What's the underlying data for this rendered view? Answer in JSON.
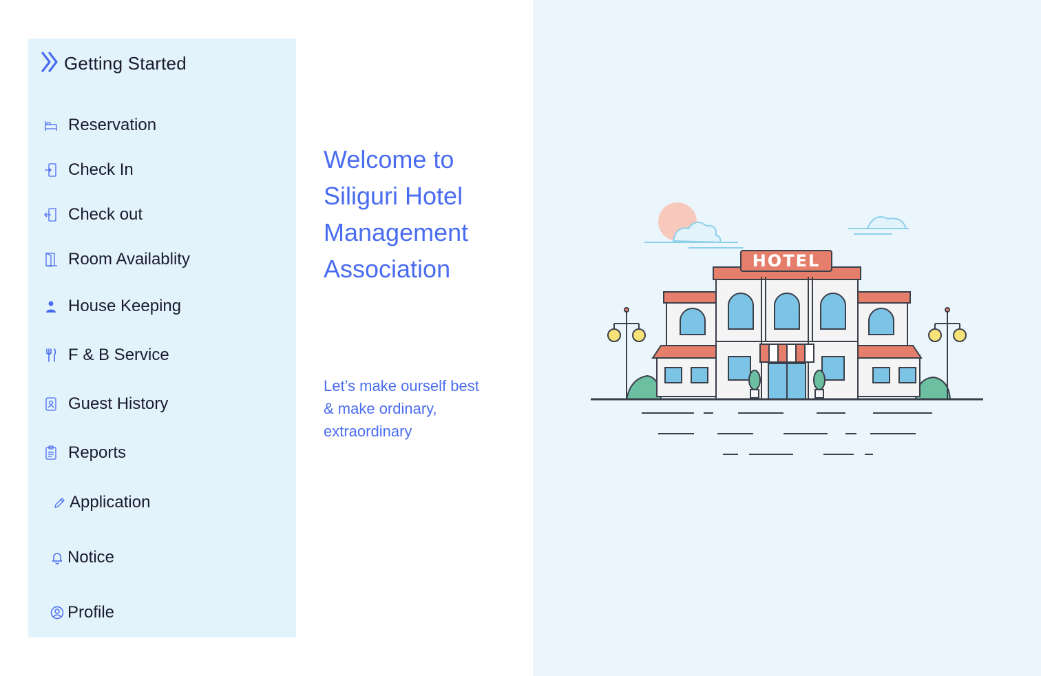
{
  "sidebar": {
    "header": {
      "label": "Getting Started",
      "icon": "double-chevron-right-icon"
    },
    "items": [
      {
        "label": "Reservation",
        "icon": "bed-icon"
      },
      {
        "label": "Check In",
        "icon": "door-enter-icon"
      },
      {
        "label": "Check out",
        "icon": "door-exit-icon"
      },
      {
        "label": "Room Availablity",
        "icon": "door-open-icon"
      },
      {
        "label": "House Keeping",
        "icon": "staff-person-icon"
      },
      {
        "label": "F & B Service",
        "icon": "fork-knife-icon"
      },
      {
        "label": "Guest History",
        "icon": "guest-id-icon"
      },
      {
        "label": "Reports",
        "icon": "clipboard-icon"
      },
      {
        "label": "Application",
        "icon": "pencil-icon"
      },
      {
        "label": "Notice",
        "icon": "bell-icon"
      },
      {
        "label": "Profile",
        "icon": "user-circle-icon"
      }
    ]
  },
  "main": {
    "welcome_lines": [
      "Welcome to",
      "Siliguri Hotel",
      "Management",
      "Association"
    ],
    "tagline_lines": [
      "Let’s make ourself best",
      "& make ordinary,",
      "extraordinary"
    ]
  },
  "illustration": {
    "sign_text": "HOTEL",
    "icon": "hotel-building-illustration"
  },
  "colors": {
    "accent": "#4a6cf0",
    "sidebar_bg": "#e3f3fc",
    "right_panel_bg": "#ebf6fc",
    "hotel_roof": "#e57f6b",
    "hotel_glass": "#7cc4e6"
  }
}
